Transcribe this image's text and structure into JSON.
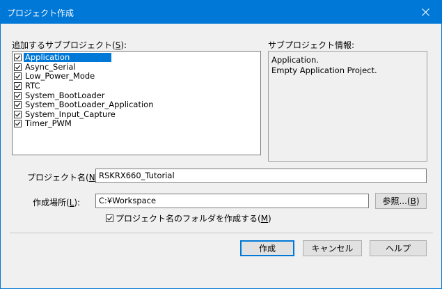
{
  "window": {
    "title": "プロジェクト作成"
  },
  "subprojects": {
    "label": "追加するサブプロジェクト(",
    "mnemonic": "S",
    "label_end": "):",
    "items": [
      {
        "label": "Application",
        "checked": true,
        "selected": true
      },
      {
        "label": "Async_Serial",
        "checked": true,
        "selected": false
      },
      {
        "label": "Low_Power_Mode",
        "checked": true,
        "selected": false
      },
      {
        "label": "RTC",
        "checked": true,
        "selected": false
      },
      {
        "label": "System_BootLoader",
        "checked": true,
        "selected": false
      },
      {
        "label": "System_BootLoader_Application",
        "checked": true,
        "selected": false
      },
      {
        "label": "System_Input_Capture",
        "checked": true,
        "selected": false
      },
      {
        "label": "Timer_PWM",
        "checked": true,
        "selected": false
      }
    ]
  },
  "info": {
    "label": "サブプロジェクト情報:",
    "line1": "Application.",
    "line2": "Empty Application Project."
  },
  "project_name": {
    "label": "プロジェクト名(",
    "mnemonic": "N",
    "label_end": "):",
    "value": "RSKRX660_Tutorial"
  },
  "location": {
    "label": "作成場所(",
    "mnemonic": "L",
    "label_end": "):",
    "value": "C:¥Workspace",
    "browse_label": "参照...(",
    "browse_mnemonic": "B",
    "browse_end": ")"
  },
  "create_folder": {
    "label": "プロジェクト名のフォルダを作成する(",
    "mnemonic": "M",
    "label_end": ")",
    "checked": true
  },
  "buttons": {
    "create": "作成",
    "cancel": "キャンセル",
    "help": "ヘルプ"
  }
}
